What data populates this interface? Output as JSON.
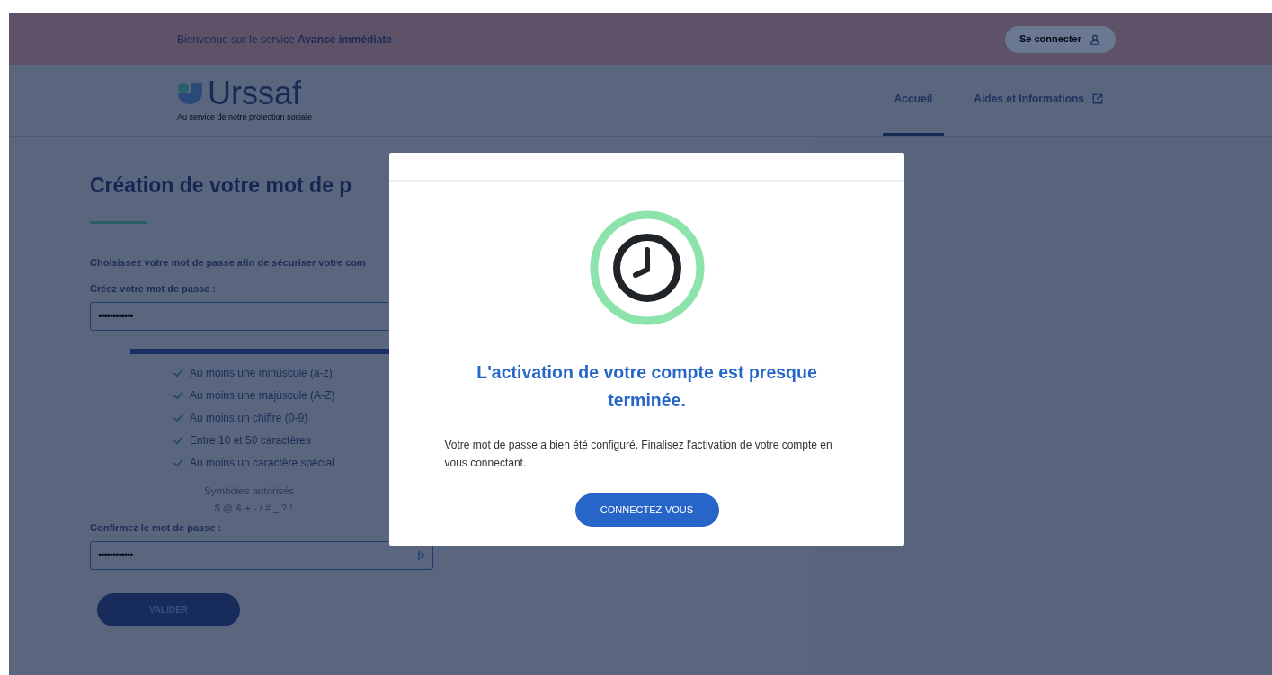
{
  "top_bar": {
    "welcome": "Bienvenue sur le service **Avance immédiate**",
    "login_button": "Se connecter"
  },
  "header": {
    "logo": {
      "name": "Urssaf",
      "tagline": "Au service de notre protection sociale"
    },
    "nav": [
      {
        "label": "Accueil",
        "selected": true,
        "external": false
      },
      {
        "label": "Aides et Informations",
        "selected": false,
        "external": true
      }
    ]
  },
  "form": {
    "title": "Création de votre mot de p",
    "intro": "Choisissez votre mot de passe afin de sécuriser votre com",
    "password_label": "Créez votre mot de passe :",
    "password_value": "••••••••••••",
    "strength": {
      "level": 1
    },
    "criteria": [
      {
        "label": "Au moins une minuscule (a-z)",
        "met": true
      },
      {
        "label": "Au moins une majuscule (A-Z)",
        "met": true
      },
      {
        "label": "Au moins un chiffre (0-9)",
        "met": true
      },
      {
        "label": "Entre 10 et 50 caractères",
        "met": true
      },
      {
        "label": "Au moins un caractère spécial",
        "met": true
      }
    ],
    "symbols_title": "Symboles autorisés",
    "symbols": "$ @ & + - / # _ ? !",
    "confirm_label": "Confirmez le mot de passe :",
    "confirm_value": "••••••••••••",
    "submit": "VALIDER"
  },
  "modal": {
    "title": "L'activation de votre compte est presque terminée.",
    "message": "Votre mot de passe a bien été configuré. Finalisez l'activation de votre compte en vous connectant.",
    "button": "CONNECTEZ-VOUS"
  }
}
